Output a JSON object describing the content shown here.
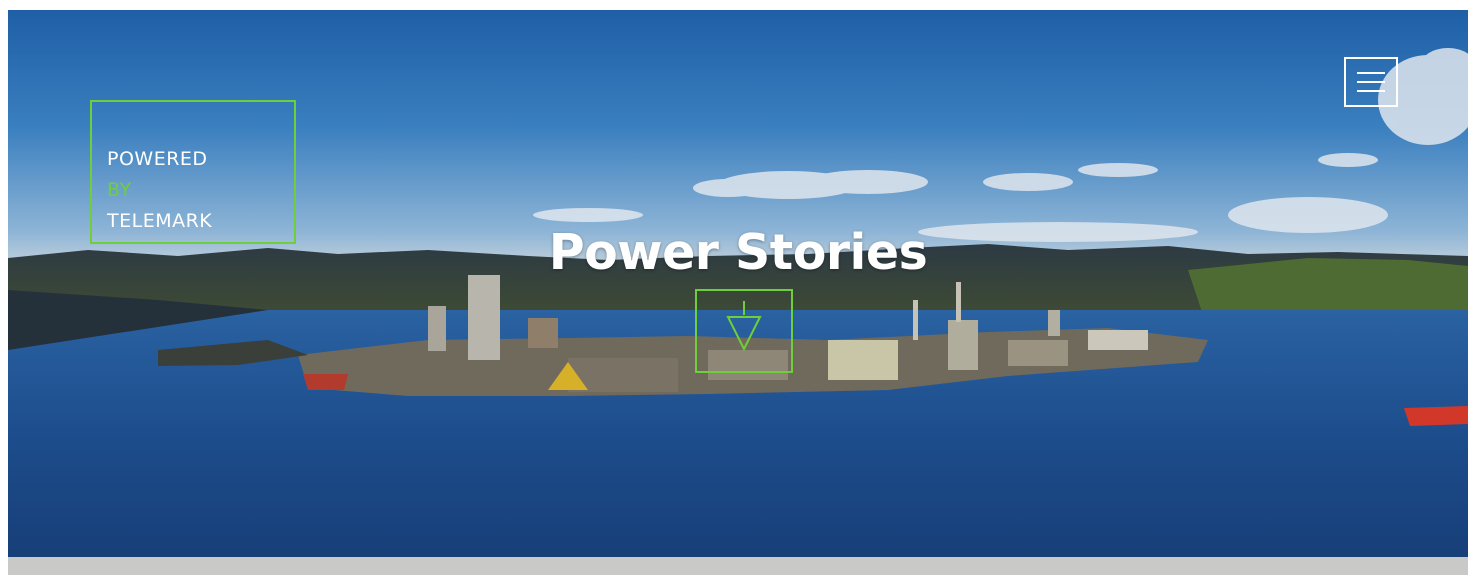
{
  "hero": {
    "title": "Power Stories"
  },
  "logo": {
    "line1": "POWERED",
    "line2": "BY",
    "line3": "TELEMARK"
  },
  "icons": {
    "menu": "hamburger-menu-icon",
    "scroll": "arrow-down-icon"
  },
  "colors": {
    "accent": "#6fcf3a",
    "text": "#ffffff",
    "sky": "#2f6fb0",
    "water": "#1e4f8f",
    "strip": "#c9c9c7"
  }
}
